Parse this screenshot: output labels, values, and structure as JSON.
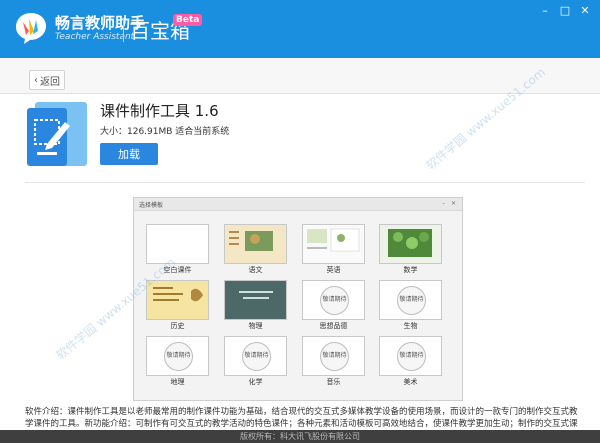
{
  "titlebar": {
    "brand_cn": "畅言教师助手",
    "brand_en": "Teacher Assistant",
    "app_title": "百宝箱",
    "badge": "Beta",
    "controls": [
      "–",
      "□",
      "✕"
    ]
  },
  "backbar": {
    "back_label": "返回"
  },
  "app": {
    "name": "课件制作工具 1.6",
    "size_line": "大小：126.91MB  适合当前系统",
    "load_label": "加载"
  },
  "preview": {
    "window_title": "选择模板",
    "controls": "– ✕",
    "templates": [
      {
        "label": "空白课件",
        "kind": "blank"
      },
      {
        "label": "语文",
        "kind": "chinese"
      },
      {
        "label": "英语",
        "kind": "english"
      },
      {
        "label": "数学",
        "kind": "math"
      },
      {
        "label": "历史",
        "kind": "history"
      },
      {
        "label": "物理",
        "kind": "physics"
      },
      {
        "label": "思想品德",
        "kind": "coming-soon"
      },
      {
        "label": "生物",
        "kind": "coming-soon"
      },
      {
        "label": "地理",
        "kind": "coming-soon"
      },
      {
        "label": "化学",
        "kind": "coming-soon"
      },
      {
        "label": "音乐",
        "kind": "coming-soon"
      },
      {
        "label": "美术",
        "kind": "coming-soon"
      }
    ],
    "coming_soon_text": "敬请期待"
  },
  "description": "软件介绍：课件制作工具是以老师最常用的制作课件功能为基础，结合现代的交互式多媒体教学设备的使用场景，而设计的一款专门的制作交互式教学课件的工具。新功能介绍：可制作有可交互式的教学活动的特色课件；各种元素和活动模板可高效地结合，使课件教学更加生动；制作的交互式课件可一键...",
  "footer": "版权所有：科大讯飞股份有限公司",
  "watermark": "软件学园 www.xue51.com",
  "colors": {
    "titlebar": "#1a8fe0",
    "accent": "#2b86e0",
    "badge": "#ff5aa5"
  }
}
